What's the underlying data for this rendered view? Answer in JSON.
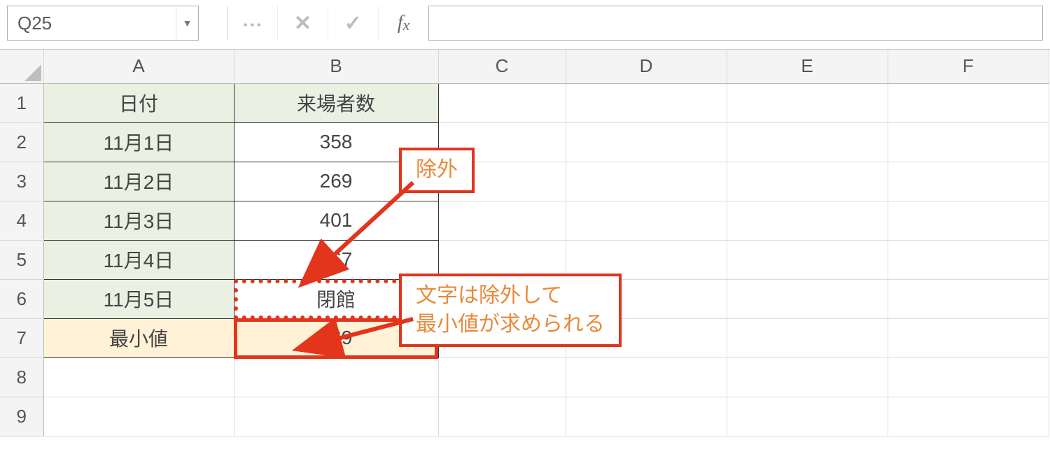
{
  "formula_bar": {
    "namebox_value": "Q25",
    "formula_value": ""
  },
  "columns": [
    "A",
    "B",
    "C",
    "D",
    "E",
    "F"
  ],
  "rows": [
    "1",
    "2",
    "3",
    "4",
    "5",
    "6",
    "7",
    "8",
    "9"
  ],
  "table": {
    "header": {
      "A": "日付",
      "B": "来場者数"
    },
    "rows": [
      {
        "A": "11月1日",
        "B": "358"
      },
      {
        "A": "11月2日",
        "B": "269"
      },
      {
        "A": "11月3日",
        "B": "401"
      },
      {
        "A": "11月4日",
        "B": "367"
      },
      {
        "A": "11月5日",
        "B": "閉館"
      }
    ],
    "footer": {
      "A": "最小値",
      "B": "269"
    }
  },
  "callouts": {
    "exclude": "除外",
    "explain": "文字は除外して\n最小値が求められる"
  },
  "icons": {
    "dropdown": "▼",
    "menu_dots": "⋮",
    "cancel": "✕",
    "accept": "✓",
    "fx_f": "f",
    "fx_x": "x"
  }
}
